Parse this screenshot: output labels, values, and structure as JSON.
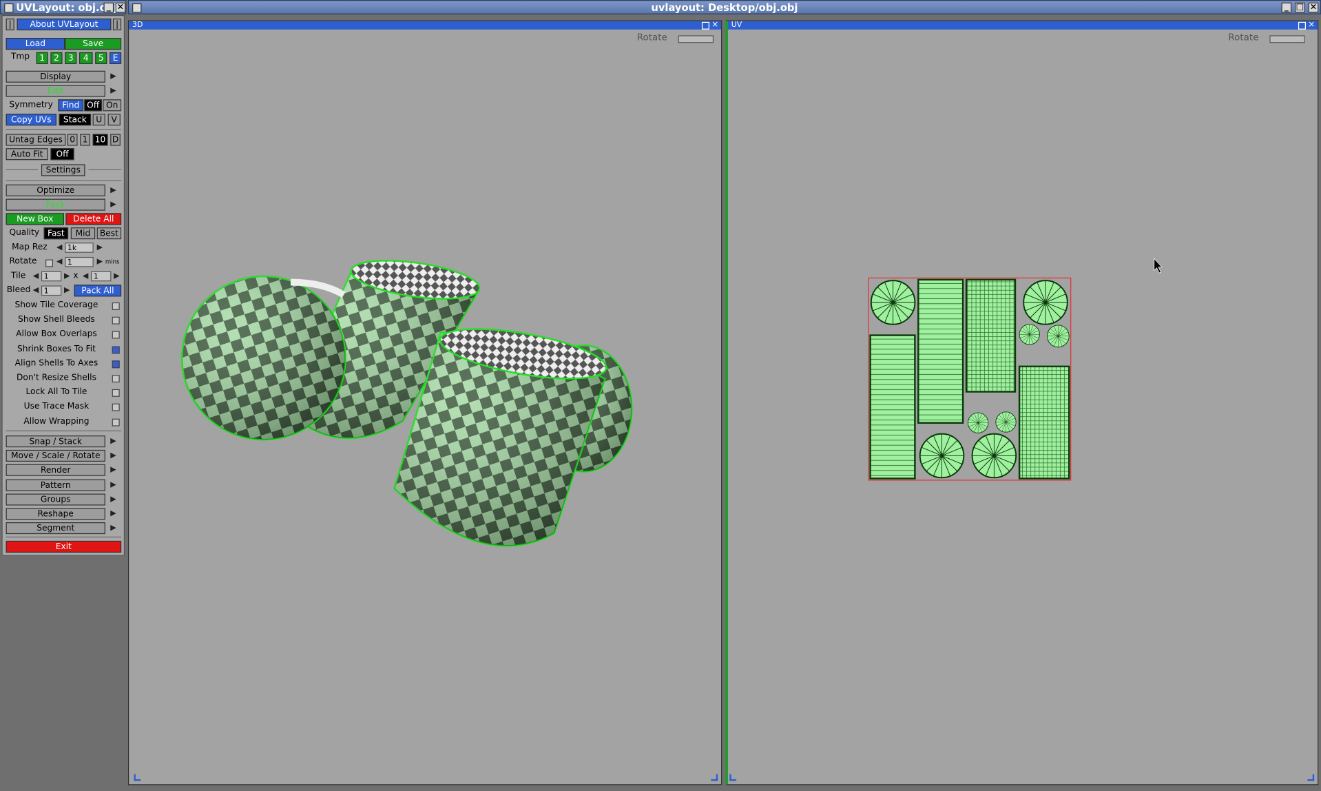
{
  "small_window": {
    "title": "UVLayout: obj.obj"
  },
  "main_window": {
    "title": "uvlayout: Desktop/obj.obj"
  },
  "panel": {
    "about": "About UVLayout",
    "load": "Load",
    "save": "Save",
    "tmp_label": "Tmp",
    "tmp_slots": [
      "1",
      "2",
      "3",
      "4",
      "5",
      "E"
    ],
    "display": "Display",
    "edit": "Edit",
    "symmetry": "Symmetry",
    "find": "Find",
    "off": "Off",
    "on": "On",
    "copy_uvs": "Copy UVs",
    "stack": "Stack",
    "u": "U",
    "v": "V",
    "untag_edges": "Untag Edges",
    "untag_opts": [
      "0",
      "1",
      "10",
      "D"
    ],
    "auto_fit": "Auto Fit",
    "auto_fit_val": "Off",
    "settings": "Settings",
    "optimize": "Optimize",
    "pack": "Pack",
    "new_box": "New Box",
    "delete_all": "Delete All",
    "quality": "Quality",
    "fast": "Fast",
    "mid": "Mid",
    "best": "Best",
    "map_rez": "Map Rez",
    "map_rez_val": "1k",
    "rotate": "Rotate",
    "rotate_val": "1",
    "rotate_unit": "mins",
    "tile": "Tile",
    "tile_x": "1",
    "tile_sep": "x",
    "tile_y": "1",
    "bleed": "Bleed",
    "bleed_val": "1",
    "pack_all": "Pack All",
    "options": [
      {
        "label": "Show Tile Coverage",
        "checked": false
      },
      {
        "label": "Show Shell Bleeds",
        "checked": false
      },
      {
        "label": "Allow Box Overlaps",
        "checked": false
      },
      {
        "label": "Shrink Boxes To Fit",
        "checked": true
      },
      {
        "label": "Align Shells To Axes",
        "checked": true
      },
      {
        "label": "Don't Resize Shells",
        "checked": false
      },
      {
        "label": "Lock All To Tile",
        "checked": false
      },
      {
        "label": "Use Trace Mask",
        "checked": false
      },
      {
        "label": "Allow Wrapping",
        "checked": false
      }
    ],
    "menus": [
      "Snap / Stack",
      "Move / Scale / Rotate",
      "Render",
      "Pattern",
      "Groups",
      "Reshape",
      "Segment"
    ],
    "exit": "Exit"
  },
  "viewport_3d": {
    "title": "3D",
    "rotate": "Rotate"
  },
  "viewport_uv": {
    "title": "UV",
    "rotate": "Rotate"
  },
  "colors": {
    "accent": "#2d5fd1",
    "green": "#1a9b22",
    "red": "#e11414",
    "mesh": "#8fe08f"
  }
}
